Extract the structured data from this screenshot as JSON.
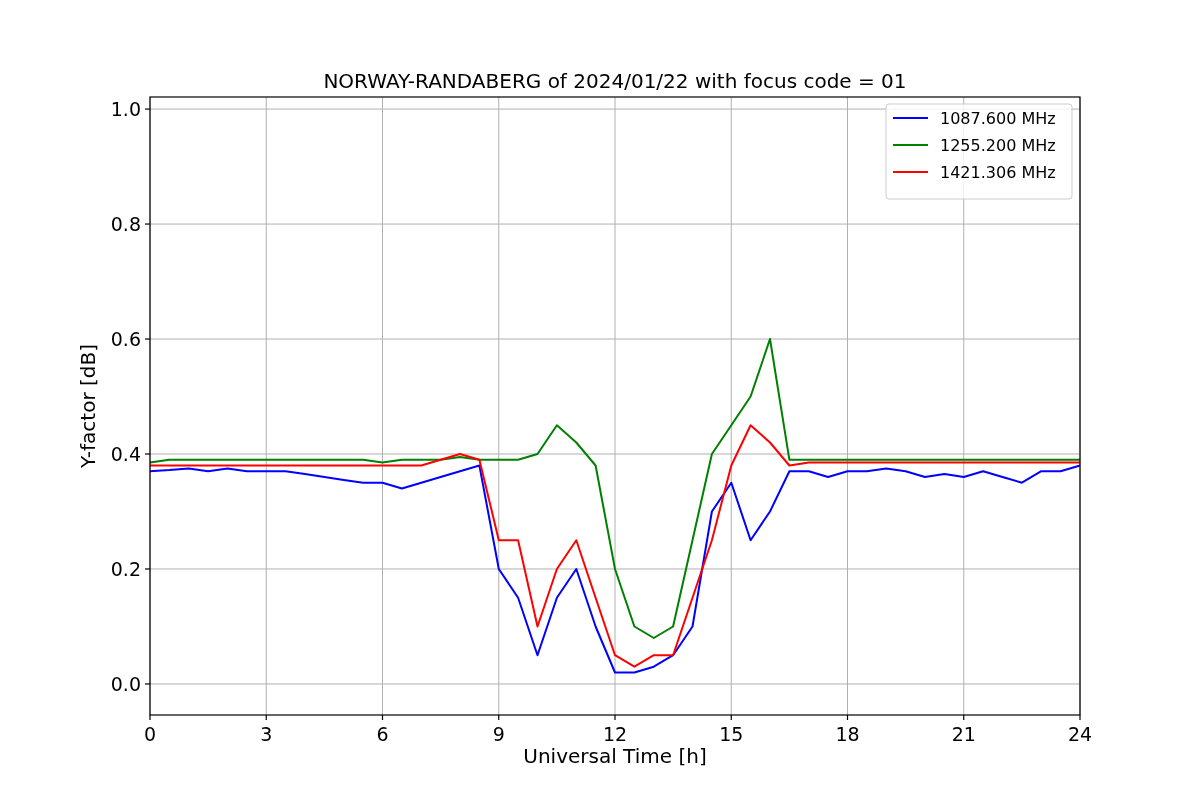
{
  "figure": {
    "chart_data": {
      "type": "line",
      "title": "NORWAY-RANDABERG of 2024/01/22 with focus code = 01",
      "xlabel": "Universal Time [h]",
      "ylabel": "Y-factor [dB]",
      "x": [
        0,
        0.5,
        1,
        1.5,
        2,
        2.5,
        3,
        3.5,
        4,
        4.5,
        5,
        5.5,
        6,
        6.5,
        7,
        7.5,
        8,
        8.5,
        9,
        9.5,
        10,
        10.5,
        11,
        11.5,
        12,
        12.5,
        13,
        13.5,
        14,
        14.5,
        15,
        15.5,
        16,
        16.5,
        17,
        17.5,
        18,
        18.5,
        19,
        19.5,
        20,
        20.5,
        21,
        21.5,
        22,
        22.5,
        23,
        23.5,
        24
      ],
      "series": [
        {
          "name": "1087.600 MHz",
          "color": "#0000ff",
          "values": [
            0.37,
            0.372,
            0.375,
            0.37,
            0.375,
            0.37,
            0.37,
            0.37,
            0.365,
            0.36,
            0.355,
            0.35,
            0.35,
            0.34,
            0.35,
            0.36,
            0.37,
            0.38,
            0.2,
            0.15,
            0.05,
            0.15,
            0.2,
            0.1,
            0.02,
            0.02,
            0.03,
            0.05,
            0.1,
            0.3,
            0.35,
            0.25,
            0.3,
            0.37,
            0.37,
            0.36,
            0.37,
            0.37,
            0.375,
            0.37,
            0.36,
            0.365,
            0.36,
            0.37,
            0.36,
            0.35,
            0.37,
            0.37,
            0.38
          ]
        },
        {
          "name": "1255.200 MHz",
          "color": "#008000",
          "values": [
            0.385,
            0.39,
            0.39,
            0.39,
            0.39,
            0.39,
            0.39,
            0.39,
            0.39,
            0.39,
            0.39,
            0.39,
            0.385,
            0.39,
            0.39,
            0.39,
            0.395,
            0.39,
            0.39,
            0.39,
            0.4,
            0.45,
            0.42,
            0.38,
            0.2,
            0.1,
            0.08,
            0.1,
            0.25,
            0.4,
            0.45,
            0.5,
            0.6,
            0.39,
            0.39,
            0.39,
            0.39,
            0.39,
            0.39,
            0.39,
            0.39,
            0.39,
            0.39,
            0.39,
            0.39,
            0.39,
            0.39,
            0.39,
            0.39
          ]
        },
        {
          "name": "1421.306 MHz",
          "color": "#ff0000",
          "values": [
            0.38,
            0.38,
            0.38,
            0.38,
            0.38,
            0.38,
            0.38,
            0.38,
            0.38,
            0.38,
            0.38,
            0.38,
            0.38,
            0.38,
            0.38,
            0.39,
            0.4,
            0.39,
            0.25,
            0.25,
            0.1,
            0.2,
            0.25,
            0.15,
            0.05,
            0.03,
            0.05,
            0.05,
            0.15,
            0.25,
            0.38,
            0.45,
            0.42,
            0.38,
            0.385,
            0.385,
            0.385,
            0.385,
            0.385,
            0.385,
            0.385,
            0.385,
            0.385,
            0.385,
            0.385,
            0.385,
            0.385,
            0.385,
            0.385
          ]
        }
      ],
      "grid": true,
      "legend": true,
      "xlim": [
        0,
        24
      ],
      "ylim": [
        -0.054,
        1.021
      ],
      "xticks": [
        0,
        3,
        6,
        9,
        12,
        15,
        18,
        21,
        24
      ],
      "yticks": [
        {
          "value": 0,
          "label": "0.0"
        },
        {
          "value": 0.2,
          "label": "0.2"
        },
        {
          "value": 0.4,
          "label": "0.4"
        },
        {
          "value": 0.6,
          "label": "0.6"
        },
        {
          "value": 0.8,
          "label": "0.8"
        },
        {
          "value": 1,
          "label": "1.0"
        }
      ]
    }
  }
}
